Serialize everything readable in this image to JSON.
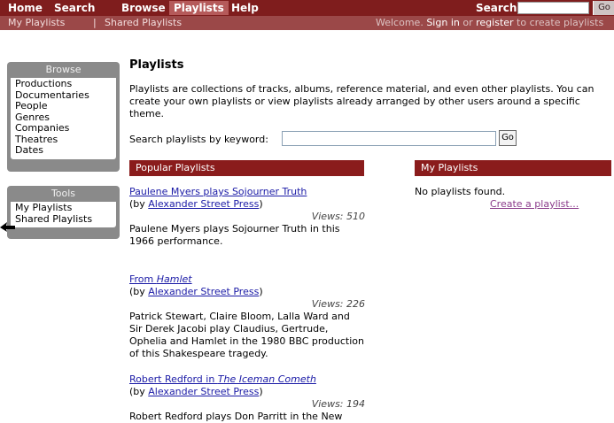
{
  "nav": {
    "home": "Home",
    "search": "Search",
    "browse": "Browse",
    "playlists": "Playlists",
    "help": "Help",
    "search_label": "Search",
    "go": "Go"
  },
  "subnav": {
    "my_playlists": "My Playlists",
    "separator": "|",
    "shared_playlists": "Shared Playlists",
    "welcome": "Welcome.",
    "sign_in": "Sign in",
    "or": "or",
    "register": "register",
    "to_create": "to create playlists"
  },
  "browse_box": {
    "title": "Browse",
    "items": [
      "Productions",
      "Documentaries",
      "People",
      "Genres",
      "Companies",
      "Theatres",
      "Dates"
    ]
  },
  "tools_box": {
    "title": "Tools",
    "items": [
      "My Playlists",
      "Shared Playlists"
    ]
  },
  "page": {
    "title": "Playlists",
    "description": "Playlists are collections of tracks, albums, reference material, and even other playlists. You can create your own playlists or view playlists already arranged by other users around a specific theme.",
    "keyword_label": "Search playlists by keyword:",
    "keyword_value": "",
    "keyword_go": "Go"
  },
  "popular": {
    "heading": "Popular Playlists",
    "items": [
      {
        "title": "Paulene Myers plays Sojourner Truth",
        "by_prefix": "(by ",
        "author": "Alexander Street Press",
        "by_suffix": ")",
        "views": "Views: 510",
        "description": "Paulene Myers plays Sojourner Truth in this 1966 performance."
      },
      {
        "title_plain": "From ",
        "title_italic": "Hamlet",
        "by_prefix": "(by ",
        "author": "Alexander Street Press",
        "by_suffix": ")",
        "views": "Views: 226",
        "description": "Patrick Stewart, Claire Bloom, Lalla Ward and Sir Derek Jacobi play Claudius, Gertrude, Ophelia and Hamlet in the 1980 BBC production of this Shakespeare tragedy."
      },
      {
        "title_plain": "Robert Redford in ",
        "title_italic": "The Iceman Cometh",
        "by_prefix": "(by ",
        "author": "Alexander Street Press",
        "by_suffix": ")",
        "views": "Views: 194",
        "description": "Robert Redford plays Don Parritt in the New"
      }
    ]
  },
  "my_playlists": {
    "heading": "My Playlists",
    "empty": "No playlists found.",
    "create": "Create a playlist..."
  },
  "colors": {
    "nav_bg": "#7f1d1d",
    "subnav_bg": "#9b4848",
    "section_head": "#8a1c1c",
    "sidebar_box": "#8a8a8a",
    "link": "#1a1aa6"
  }
}
